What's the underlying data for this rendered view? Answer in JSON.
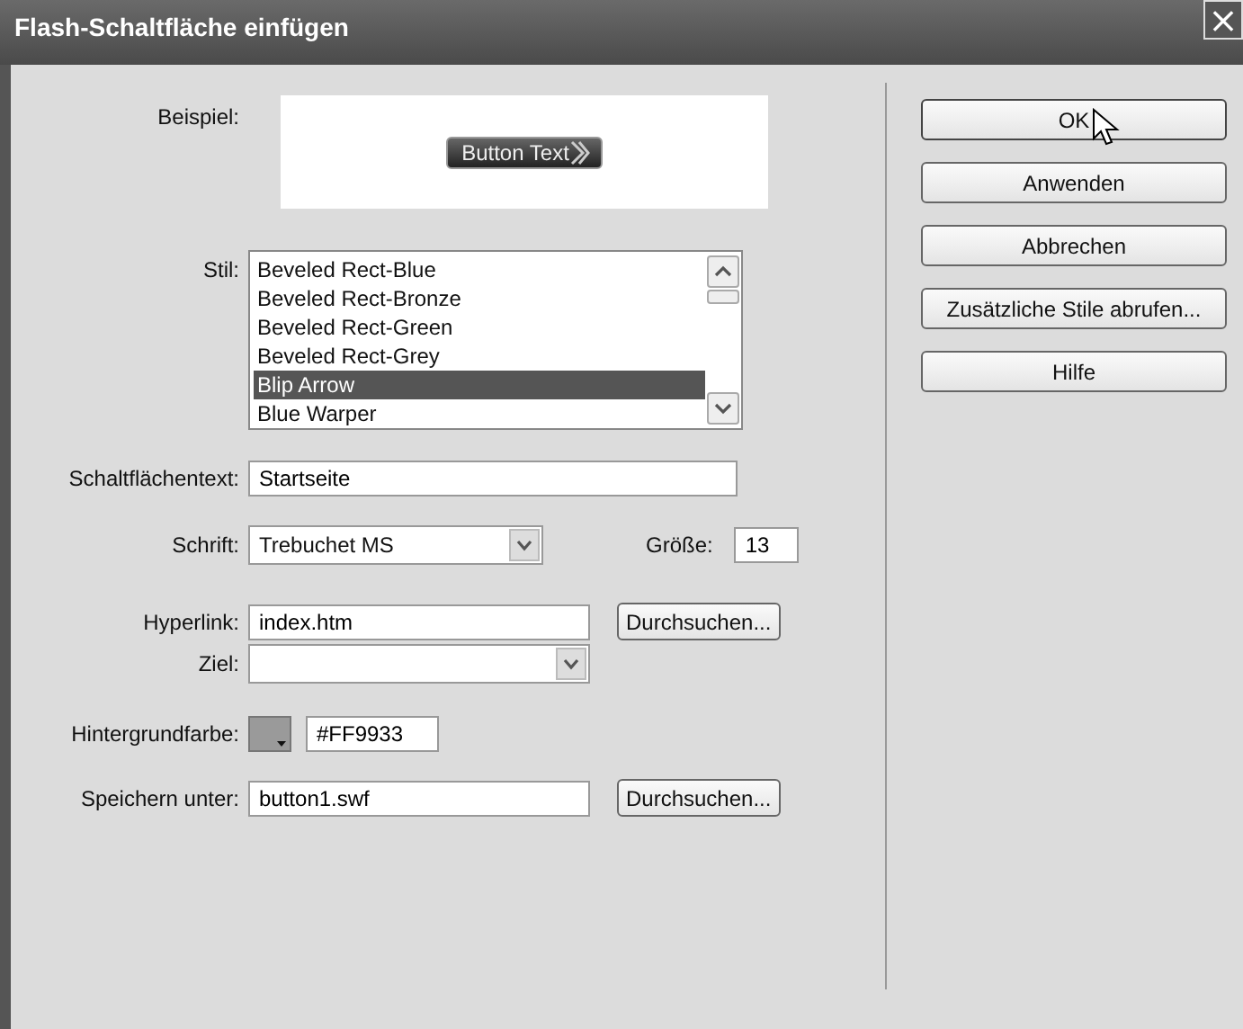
{
  "window": {
    "title": "Flash-Schaltfläche einfügen",
    "close": "×"
  },
  "preview": {
    "label": "Beispiel:",
    "button_text": "Button Text"
  },
  "style_list": {
    "label": "Stil:",
    "items": [
      {
        "text": "Beveled Rect-Blue",
        "selected": false
      },
      {
        "text": "Beveled Rect-Bronze",
        "selected": false
      },
      {
        "text": "Beveled Rect-Green",
        "selected": false
      },
      {
        "text": "Beveled Rect-Grey",
        "selected": false
      },
      {
        "text": "Blip Arrow",
        "selected": true
      },
      {
        "text": "Blue Warper",
        "selected": false
      }
    ]
  },
  "button_text": {
    "label": "Schaltflächentext:",
    "value": "Startseite"
  },
  "font": {
    "label": "Schrift:",
    "value": "Trebuchet MS",
    "size_label": "Größe:",
    "size": "13"
  },
  "hyperlink": {
    "label": "Hyperlink:",
    "value": "index.htm",
    "browse": "Durchsuchen..."
  },
  "target": {
    "label": "Ziel:"
  },
  "background": {
    "label": "Hintergrundfarbe:",
    "value": "#FF9933"
  },
  "save_as": {
    "label": "Speichern unter:",
    "value": "button1.swf",
    "browse": "Durchsuchen..."
  },
  "buttons": [
    {
      "label": "OK",
      "hover": true
    },
    {
      "label": "Anwenden",
      "hover": false
    },
    {
      "label": "Abbrechen",
      "hover": false
    },
    {
      "label": "Zusätzliche Stile abrufen...",
      "hover": false
    },
    {
      "label": "Hilfe",
      "hover": false
    }
  ]
}
